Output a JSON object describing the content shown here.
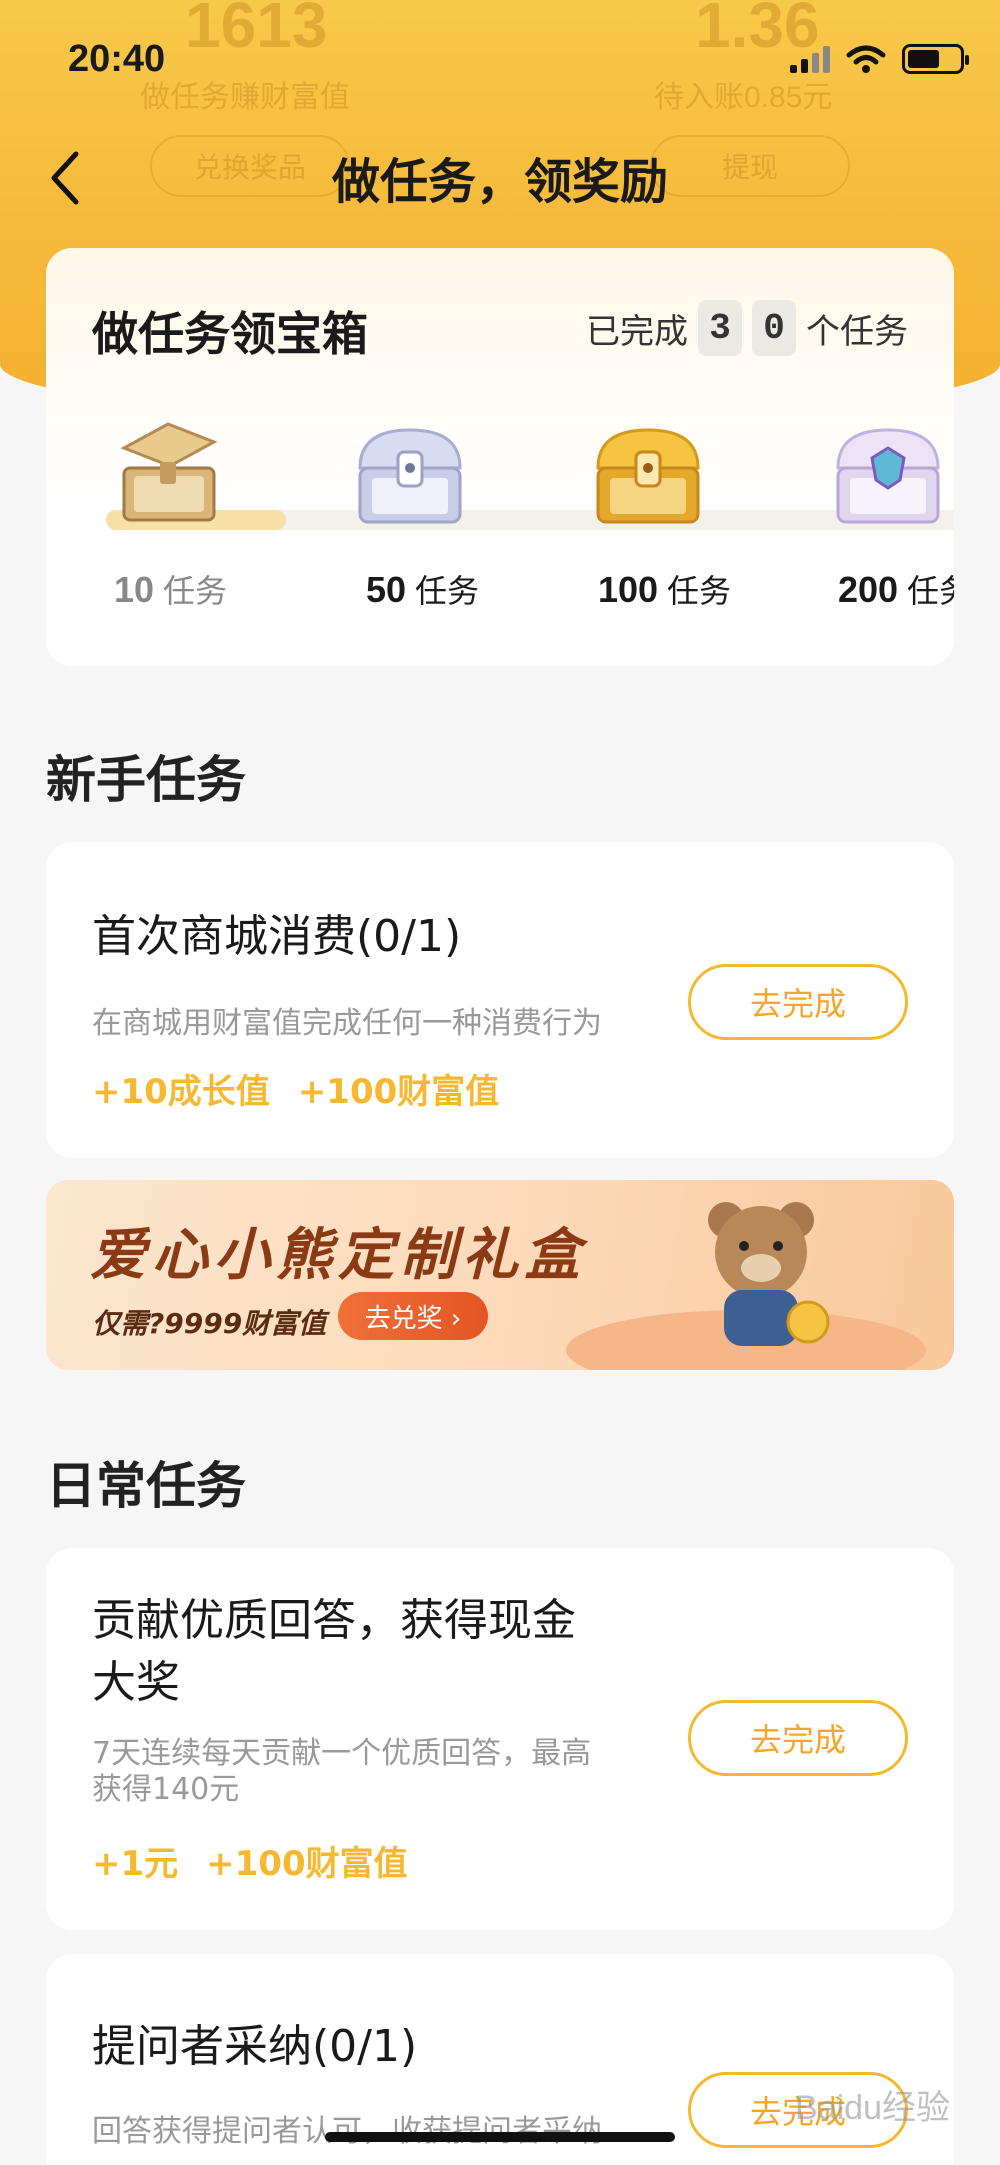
{
  "status_bar": {
    "time": "20:40"
  },
  "background_header": {
    "left_value": "1613",
    "left_label": "做任务赚财富值",
    "right_value": "1.36",
    "right_label": "待入账0.85元",
    "left_button": "兑换奖品",
    "right_button": "提现"
  },
  "nav": {
    "title": "做任务，领奖励"
  },
  "treasure": {
    "title": "做任务领宝箱",
    "progress_prefix": "已完成",
    "progress_digits": [
      "3",
      "0"
    ],
    "progress_suffix": "个任务",
    "chests": [
      {
        "count": "10",
        "unit": "任务",
        "icon": "wooden-chest-icon"
      },
      {
        "count": "50",
        "unit": "任务",
        "icon": "silver-chest-icon"
      },
      {
        "count": "100",
        "unit": "任务",
        "icon": "gold-chest-icon"
      },
      {
        "count": "200",
        "unit": "任务",
        "icon": "crystal-chest-icon"
      }
    ]
  },
  "newbie_section": {
    "title": "新手任务",
    "tasks": [
      {
        "title": "首次商城消费(0/1)",
        "desc": "在商城用财富值完成任何一种消费行为",
        "rewards": [
          "+10成长值",
          "+100财富值"
        ],
        "button": "去完成"
      }
    ]
  },
  "banner": {
    "title": "爱心小熊定制礼盒",
    "subtitle": "仅需?9999财富值",
    "button": "去兑奖 ›"
  },
  "daily_section": {
    "title": "日常任务",
    "tasks": [
      {
        "title_line1": "贡献优质回答，获得现金",
        "title_line2": "大奖",
        "desc_line1": "7天连续每天贡献一个优质回答，最高",
        "desc_line2": "获得140元",
        "rewards": [
          "+1元",
          "+100财富值"
        ],
        "button": "去完成"
      },
      {
        "title": "提问者采纳(0/1)",
        "desc": "回答获得提问者认可，收获提问者采纳",
        "button": "去完成"
      }
    ]
  },
  "watermark": "Baidu经验",
  "colors": {
    "accent": "#f5b830",
    "header": "#f6b93a",
    "banner_text": "#8a3b15"
  }
}
